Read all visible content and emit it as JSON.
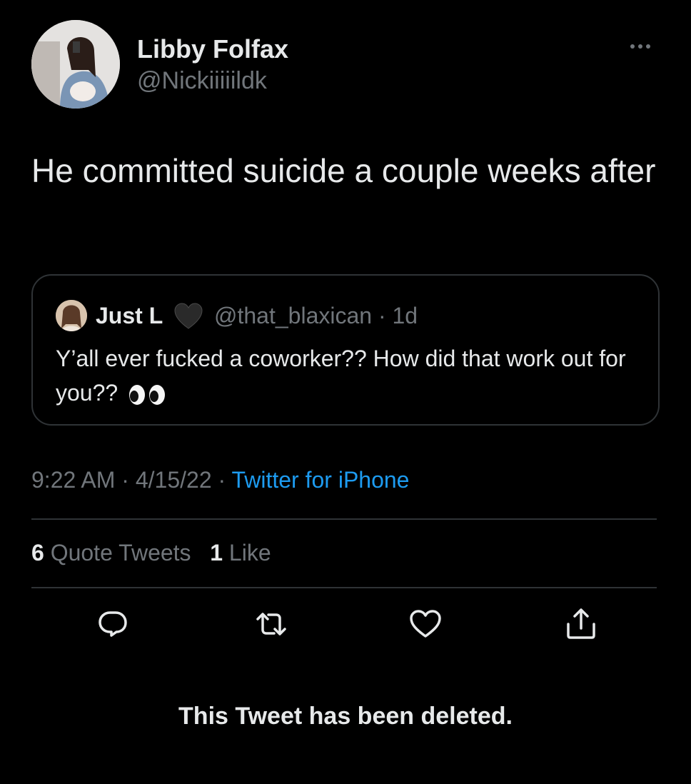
{
  "tweet": {
    "author": {
      "display_name": "Libby Folfax",
      "handle": "@Nickiiiiildk",
      "avatar_icon": "profile-photo-avatar"
    },
    "more_icon": "ellipsis-icon",
    "text": "He committed suicide a couple weeks after",
    "quoted": {
      "display_name": "Just L",
      "name_emoji": "black-heart-icon",
      "handle": "@that_blaxican",
      "separator": "·",
      "time_ago": "1d",
      "text": "Y’all ever fucked a coworker?? How did that work out for you??",
      "trailing_emoji": "eyes-emoji-icon"
    },
    "timestamp": {
      "time": "9:22 AM",
      "sep1": "·",
      "date": "4/15/22",
      "sep2": "·",
      "source": "Twitter for iPhone"
    },
    "stats": {
      "quote_count": "6",
      "quote_label": "Quote Tweets",
      "like_count": "1",
      "like_label": "Like"
    },
    "actions": [
      {
        "name": "reply",
        "icon": "reply-icon"
      },
      {
        "name": "retweet",
        "icon": "retweet-icon"
      },
      {
        "name": "like",
        "icon": "heart-icon"
      },
      {
        "name": "share",
        "icon": "share-icon"
      }
    ],
    "deleted_notice": "This Tweet has been deleted."
  },
  "colors": {
    "background": "#000000",
    "primary_text": "#e7e9ea",
    "secondary_text": "#71767b",
    "link": "#1d9bf0",
    "border": "#2f3336"
  }
}
